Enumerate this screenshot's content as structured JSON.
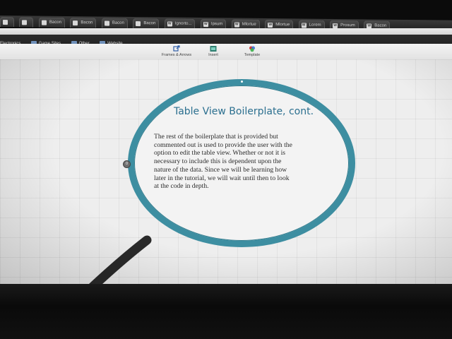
{
  "browser": {
    "tabs": [
      {
        "label": "",
        "favicon": ""
      },
      {
        "label": "",
        "favicon": ""
      },
      {
        "label": "Bacon",
        "favicon": ""
      },
      {
        "label": "Bacon",
        "favicon": ""
      },
      {
        "label": "Bacon",
        "favicon": ""
      },
      {
        "label": "Bacon",
        "favicon": ""
      },
      {
        "label": "Ignorto...",
        "favicon": "W"
      },
      {
        "label": "Ipsum",
        "favicon": "W"
      },
      {
        "label": "Mlortue",
        "favicon": "W"
      },
      {
        "label": "Mlortue",
        "favicon": "W"
      },
      {
        "label": "Lorem",
        "favicon": "W"
      },
      {
        "label": "Prosum",
        "favicon": "W"
      },
      {
        "label": "Bacon",
        "favicon": "W"
      }
    ],
    "bookmarks": [
      {
        "label": "Electronics"
      },
      {
        "label": "Game Sites"
      },
      {
        "label": "Other"
      },
      {
        "label": "Website"
      }
    ]
  },
  "toolbar": {
    "items": [
      {
        "label": "Frames & Arrows"
      },
      {
        "label": "Insert"
      },
      {
        "label": "Template"
      }
    ]
  },
  "slide": {
    "title": "Table View Boilerplate, cont.",
    "body_lines": [
      "The rest of the boilerplate that is provided but",
      "commented out is used to provide the user with the",
      "option to edit the table view. Whether or not it is",
      "necessary to include this is dependent upon the",
      "nature of the data. Since we will be learning how",
      "later in the tutorial, we will wait until then to look",
      "at the code in depth."
    ],
    "side_handle_label": "0"
  },
  "colors": {
    "ring": "#3d8ea1",
    "title": "#2b6f8f",
    "canvas": "#eeeeee"
  }
}
